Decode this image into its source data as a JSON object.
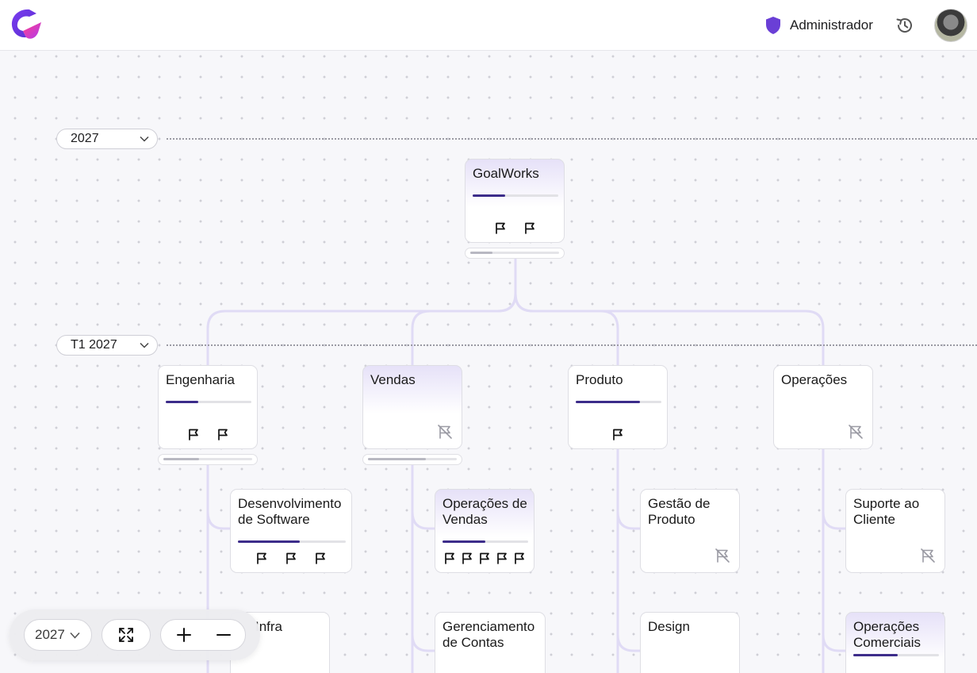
{
  "header": {
    "role_label": "Administrador",
    "logo_icon": "goalworks-logo",
    "role_icon": "shield-icon",
    "history_icon": "history-icon",
    "avatar_icon": "user-avatar"
  },
  "periods": [
    {
      "label": "2027"
    },
    {
      "label": "T1 2027"
    }
  ],
  "cards": {
    "root": {
      "title": "GoalWorks",
      "progress": 0.38,
      "goals": 2
    },
    "engenharia": {
      "title": "Engenharia",
      "progress": 0.38,
      "goals": 2
    },
    "vendas": {
      "title": "Vendas",
      "goals": 0
    },
    "produto": {
      "title": "Produto",
      "progress": 0.75,
      "goals": 1
    },
    "operacoes": {
      "title": "Operações",
      "goals": 0
    },
    "desenvolvimento": {
      "title": "Desenvolvimento de Software",
      "progress": 0.57,
      "goals": 3
    },
    "op_vendas": {
      "title": "Operações de Vendas",
      "progress": 0.5,
      "goals": 5
    },
    "gestao_produto": {
      "title": "Gestão de Produto",
      "goals": 0
    },
    "suporte": {
      "title": "Suporte ao Cliente",
      "goals": 0
    },
    "infra": {
      "title": "Infra"
    },
    "contas": {
      "title": "Gerenciamento de Contas"
    },
    "design": {
      "title": "Design"
    },
    "op_comerciais": {
      "title": "Operações Comerciais",
      "progress": 0.52
    }
  },
  "subprogress": {
    "root": 0.25,
    "engenharia": 0.4,
    "vendas": 0.65
  },
  "toolbar": {
    "period_value": "2027",
    "fit_icon": "fit-screen-icon",
    "zoom_in_icon": "plus-icon",
    "zoom_out_icon": "minus-icon"
  },
  "colors": {
    "accent": "#6a3fd6",
    "progress": "#3c2c8a",
    "connector": "#e0dbf5"
  }
}
